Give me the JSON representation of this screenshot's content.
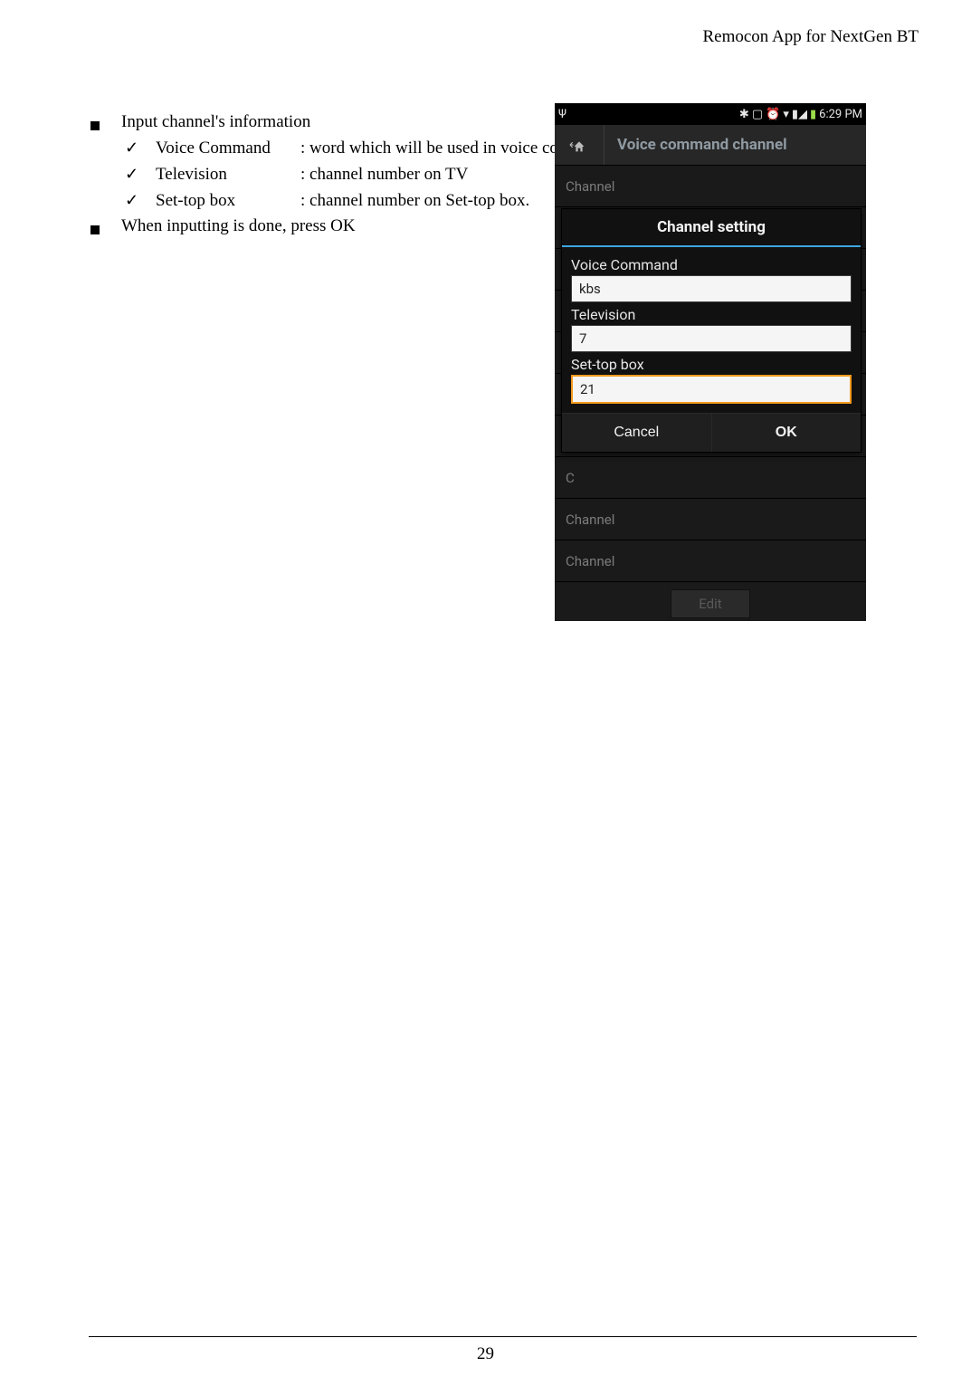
{
  "header": {
    "title": "Remocon App for NextGen BT"
  },
  "bullets": {
    "b1": "Input channel's information",
    "sub1_term": "Voice Command",
    "sub1_desc": ": word which will be used in voice command",
    "sub2_term": "Television",
    "sub2_desc": ": channel number on TV",
    "sub3_term": "Set-top box",
    "sub3_desc": ": channel number on Set-top box.",
    "b2": "When inputting is done, press OK"
  },
  "phone": {
    "status": {
      "time": "6:29 PM"
    },
    "appbar": {
      "title": "Voice command channel"
    },
    "rows": {
      "r1": "Channel",
      "r2": "Channel",
      "r3": "Channel"
    },
    "edit": "Edit",
    "dialog": {
      "title": "Channel setting",
      "label1": "Voice Command",
      "value1": "kbs",
      "label2": "Television",
      "value2": "7",
      "label3": "Set-top box",
      "value3": "21",
      "cancel": "Cancel",
      "ok": "OK"
    }
  },
  "footer": {
    "page": "29"
  }
}
